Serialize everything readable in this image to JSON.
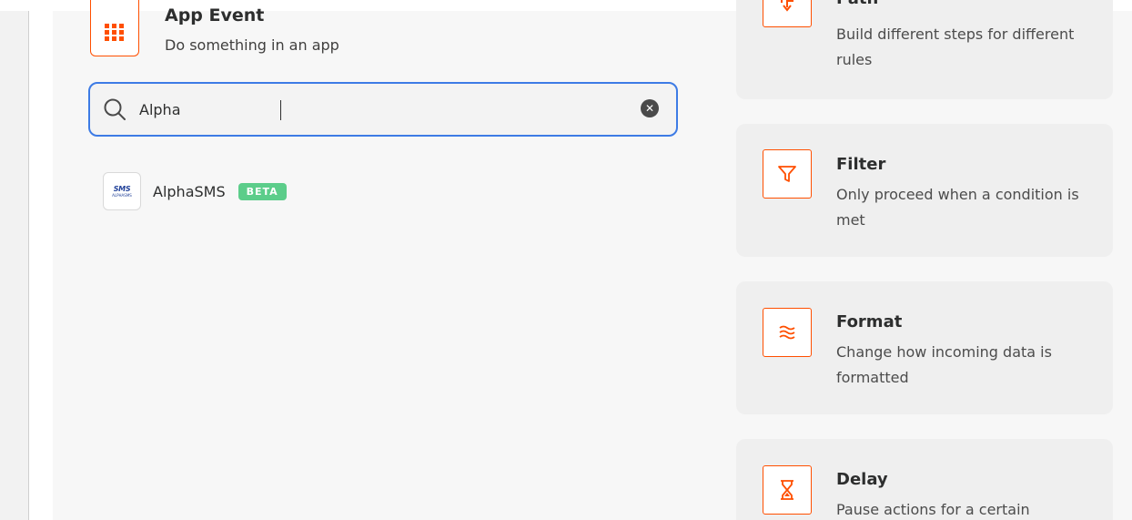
{
  "app_event": {
    "title": "App Event",
    "subtitle": "Do something in an app",
    "icon": "grid-icon"
  },
  "search": {
    "value": "Alpha",
    "placeholder": "",
    "clear_icon": "clear-icon"
  },
  "results": [
    {
      "name": "AlphaSMS",
      "badge": "BETA",
      "logo_text": "SMS",
      "logo_sub": "ALPHASMS"
    }
  ],
  "tools": [
    {
      "title": "Path",
      "description": "Build different steps for different rules",
      "icon": "path-icon"
    },
    {
      "title": "Filter",
      "description": "Only proceed when a condition is met",
      "icon": "filter-icon"
    },
    {
      "title": "Format",
      "description": "Change how incoming data is formatted",
      "icon": "format-icon"
    },
    {
      "title": "Delay",
      "description": "Pause actions for a certain",
      "icon": "hourglass-icon"
    }
  ],
  "colors": {
    "accent": "#ff4f00",
    "focus": "#3d7be5",
    "beta": "#5ccd8a"
  }
}
